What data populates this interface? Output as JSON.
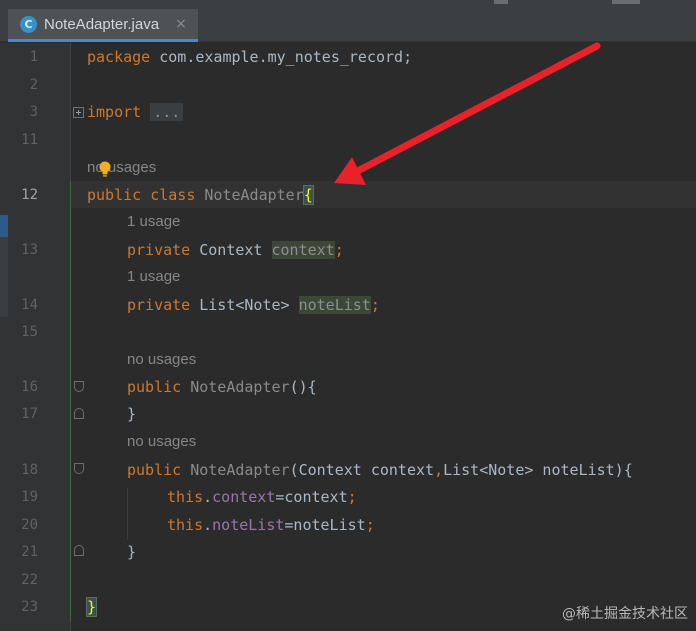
{
  "tab": {
    "icon_letter": "C",
    "title": "NoteAdapter.java",
    "close": "×"
  },
  "line_numbers": [
    "1",
    "2",
    "3",
    "11",
    "12",
    "13",
    "14",
    "15",
    "16",
    "17",
    "18",
    "19",
    "20",
    "21",
    "22",
    "23"
  ],
  "hints": {
    "class": "no usages",
    "context": "1 usage",
    "noteList": "1 usage",
    "ctor1": "no usages",
    "ctor2": "no usages"
  },
  "code": {
    "l1_kw": "package",
    "l1_rest": " com.example.my_notes_record;",
    "l3_kw": "import",
    "l3_fold": "...",
    "l12_kw": "public class",
    "l12_name": "NoteAdapter",
    "l12_brace": "{",
    "l13_kw": "private",
    "l13_type": " Context ",
    "l13_field": "context",
    "l13_semi": ";",
    "l14_kw": "private",
    "l14_type": " List<Note> ",
    "l14_field": "noteList",
    "l14_semi": ";",
    "l16_kw": "public",
    "l16_name": "NoteAdapter",
    "l16_rest": "(){",
    "l17": "}",
    "l18_kw": "public",
    "l18_name": "NoteAdapter",
    "l18_params_a": "(Context context",
    "l18_comma": ",",
    "l18_params_b": "List<Note> noteList){",
    "l19_this": "this",
    "l19_dot": ".",
    "l19_field": "context",
    "l19_rest": "=context",
    "l19_semi": ";",
    "l20_this": "this",
    "l20_dot": ".",
    "l20_field": "noteList",
    "l20_rest": "=noteList",
    "l20_semi": ";",
    "l21": "}",
    "l23": "}"
  },
  "watermark": "@稀土掘金技术社区",
  "colors": {
    "background": "#2b2b2b",
    "keyword": "#cc7832",
    "field": "#9876aa",
    "arrow": "#e8212b",
    "bulb": "#f2b01e"
  },
  "icons": {
    "tab": "java-class-icon",
    "bulb": "lightbulb-icon",
    "arrow": "red-annotation-arrow"
  }
}
